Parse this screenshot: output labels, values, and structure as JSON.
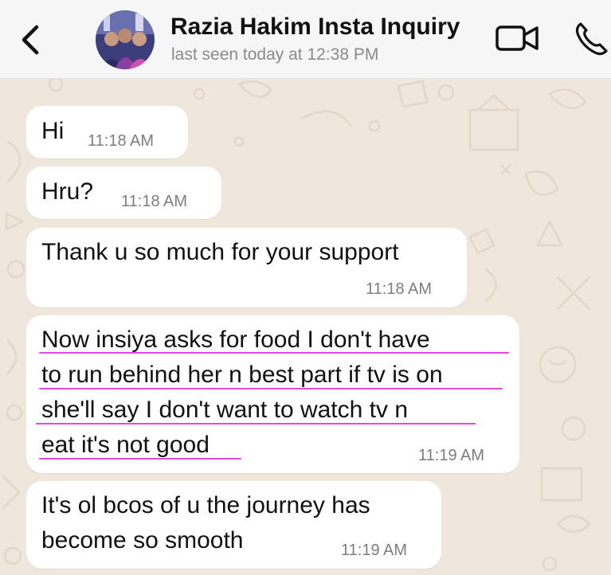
{
  "header": {
    "contact_name": "Razia Hakim Insta Inquiry",
    "last_seen": "last seen today at 12:38 PM"
  },
  "icons": {
    "back": "chevron-left-icon",
    "video": "video-camera-icon",
    "phone": "phone-icon"
  },
  "colors": {
    "chat_background": "#efe7dc",
    "bubble": "#ffffff",
    "header": "#f6f6f6",
    "highlight_underline": "#e04ae0"
  },
  "messages": [
    {
      "lines": [
        "Hi"
      ],
      "time": "11:18 AM"
    },
    {
      "lines": [
        "Hru?"
      ],
      "time": "11:18 AM"
    },
    {
      "lines": [
        "Thank u so much for your support"
      ],
      "time": "11:18 AM"
    },
    {
      "lines": [
        "Now insiya asks for food I don't have",
        "to run behind her n best part if tv is on",
        "she'll say I don't want to watch tv n",
        "eat it's not good"
      ],
      "time": "11:19 AM"
    },
    {
      "lines": [
        "It's ol bcos of u the journey has",
        "become so smooth"
      ],
      "time": "11:19 AM"
    }
  ]
}
